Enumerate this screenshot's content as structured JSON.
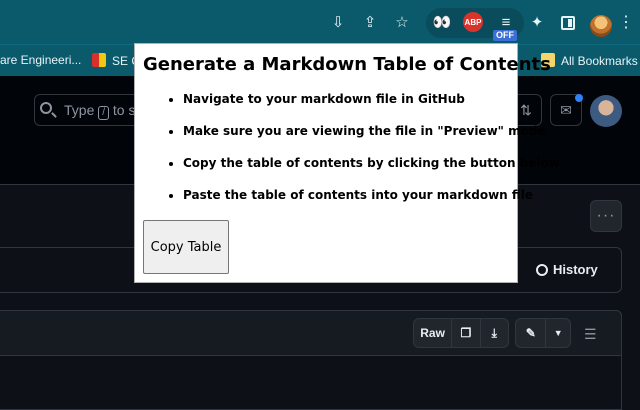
{
  "browser": {
    "extension_badge": "OFF",
    "adblock_label": "ABP"
  },
  "bookmarks": {
    "items": [
      "are Engineeri...",
      "SE C",
      "All Bookmarks"
    ]
  },
  "github": {
    "search_placeholder_1": "Type",
    "search_kbd": "/",
    "search_placeholder_2": "to s",
    "history_label": "History",
    "raw_label": "Raw"
  },
  "popup": {
    "title": "Generate a Markdown Table of Contents",
    "steps": [
      "Navigate to your markdown file in GitHub",
      "Make sure you are viewing the file in \"Preview\" mode",
      "Copy the table of contents by clicking the button below",
      "Paste the table of contents into your markdown file"
    ],
    "copy_button": "Copy Table"
  }
}
